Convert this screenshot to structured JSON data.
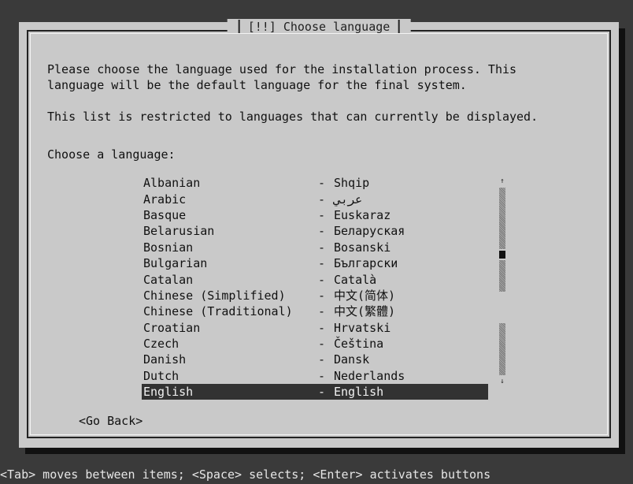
{
  "dialog": {
    "title": "[!!] Choose language",
    "intro": "Please choose the language used for the installation process. This\nlanguage will be the default language for the final system.",
    "note": "This list is restricted to languages that can currently be displayed.",
    "prompt": "Choose a language:"
  },
  "languages": [
    {
      "name": "Albanian",
      "native": "Shqip"
    },
    {
      "name": "Arabic",
      "native": "عربي"
    },
    {
      "name": "Basque",
      "native": "Euskaraz"
    },
    {
      "name": "Belarusian",
      "native": "Беларуская"
    },
    {
      "name": "Bosnian",
      "native": "Bosanski"
    },
    {
      "name": "Bulgarian",
      "native": "Български"
    },
    {
      "name": "Catalan",
      "native": "Català"
    },
    {
      "name": "Chinese (Simplified)",
      "native": "中文(简体)"
    },
    {
      "name": "Chinese (Traditional)",
      "native": "中文(繁體)"
    },
    {
      "name": "Croatian",
      "native": "Hrvatski"
    },
    {
      "name": "Czech",
      "native": "Čeština"
    },
    {
      "name": "Danish",
      "native": "Dansk"
    },
    {
      "name": "Dutch",
      "native": "Nederlands"
    },
    {
      "name": "English",
      "native": "English",
      "selected": true
    }
  ],
  "separator": "-",
  "scrollbar": {
    "up_arrow": "↑",
    "down_arrow": "↓"
  },
  "buttons": {
    "go_back": "<Go Back>"
  },
  "status_bar": "<Tab> moves between items; <Space> selects; <Enter> activates buttons"
}
